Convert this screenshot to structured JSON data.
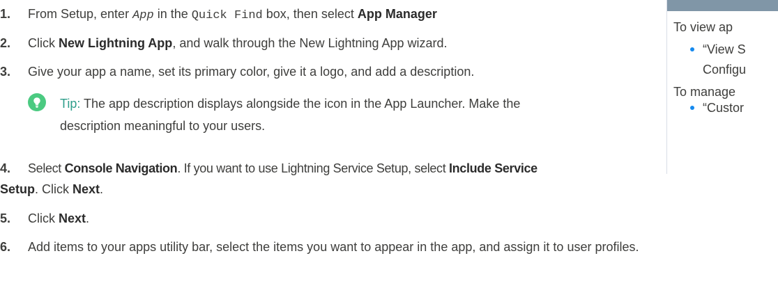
{
  "steps": [
    {
      "number": "1.",
      "parts": [
        {
          "t": "From Setup, enter ",
          "s": ""
        },
        {
          "t": "App",
          "s": "mono ital"
        },
        {
          "t": " in the ",
          "s": ""
        },
        {
          "t": "Quick Find",
          "s": "mono"
        },
        {
          "t": " box, then select ",
          "s": ""
        },
        {
          "t": "App Manager",
          "s": "b"
        }
      ]
    },
    {
      "number": "2.",
      "parts": [
        {
          "t": "Click ",
          "s": ""
        },
        {
          "t": "New Lightning App",
          "s": "b"
        },
        {
          "t": ", and walk through the New Lightning App wizard.",
          "s": ""
        }
      ]
    },
    {
      "number": "3.",
      "parts": [
        {
          "t": "Give your app a name, set its primary color, give it a logo, and add a description.",
          "s": ""
        }
      ]
    },
    {
      "number": "4.",
      "parts": [
        {
          "t": "Select ",
          "s": ""
        },
        {
          "t": "Console Navigation",
          "s": "b"
        },
        {
          "t": ". If you want to use Lightning Service Setup, select ",
          "s": ""
        },
        {
          "t": "Include Service",
          "s": "b"
        }
      ],
      "continuation": [
        {
          "t": "Setup",
          "s": "b"
        },
        {
          "t": ". Click ",
          "s": ""
        },
        {
          "t": "Next",
          "s": "b"
        },
        {
          "t": ".",
          "s": ""
        }
      ]
    },
    {
      "number": "5.",
      "parts": [
        {
          "t": "Click ",
          "s": ""
        },
        {
          "t": "Next",
          "s": "b"
        },
        {
          "t": ".",
          "s": ""
        }
      ]
    },
    {
      "number": "6.",
      "parts": [
        {
          "t": "Add items to your apps utility bar, select the items you want to appear in the app, and assign it to user profiles.",
          "s": ""
        }
      ]
    }
  ],
  "tip": {
    "label": "Tip:",
    "line1": "The app description displays alongside the icon in the App Launcher. Make the",
    "line2": "description meaningful to your users.",
    "icon": "lightbulb-icon",
    "icon_color": "#4bca81",
    "label_color": "#2e9e8a"
  },
  "sidebar": {
    "view_label": "To view ap",
    "view_items": [
      "“View S",
      "Configu"
    ],
    "manage_label": "To manage",
    "manage_items": [
      "“Custor"
    ],
    "header_color": "#8096a7",
    "bullet_color": "#1589ee"
  }
}
